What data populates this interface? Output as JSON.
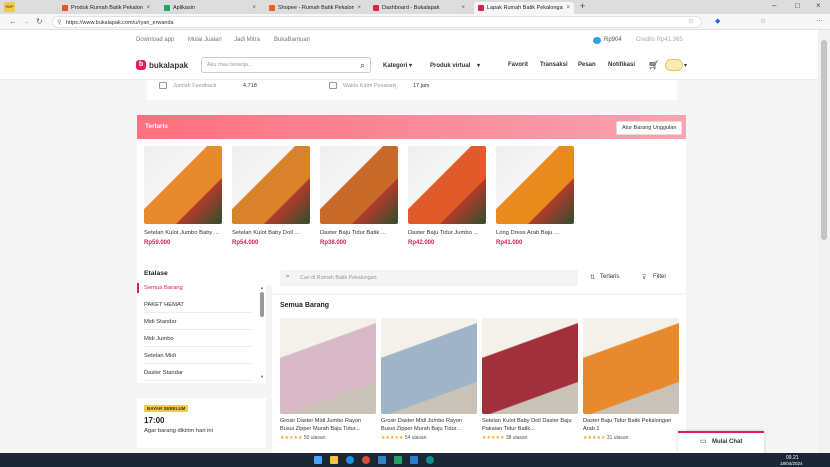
{
  "browser": {
    "tabs": [
      {
        "label": "Produk Rumah Batik Pekalongan",
        "color": "#e8541c"
      },
      {
        "label": "Aplikasin",
        "color": "#1fa463"
      },
      {
        "label": "Shopee - Rumah Batik Pekalongan",
        "color": "#f05d23"
      },
      {
        "label": "Dashboard - Bukalapak",
        "color": "#e31e52"
      },
      {
        "label": "Lapak Rumah Batik Pekalongan",
        "color": "#e31e52"
      }
    ],
    "url": "https://www.bukalapak.com/u/ryan_erwanda"
  },
  "topnav": {
    "download": "Download app",
    "jualan": "Mulai Jualan",
    "mitra": "Jadi Mitra",
    "bantuan": "BukaBantuan",
    "balance": "Rp904",
    "credits": "Credits Rp41.365"
  },
  "header": {
    "logo": "bukalapak",
    "search_placeholder": "Aku mau belanja...",
    "kategori": "Kategori",
    "produk_virtual": "Produk virtual",
    "favorit": "Favorit",
    "transaksi": "Transaksi",
    "pesan": "Pesan",
    "notifikasi": "Notifikasi"
  },
  "stats": {
    "feedback_label": "Jumlah Feedback",
    "feedback_value": "4.718",
    "waktu_label": "Waktu Kirim Pesanan",
    "waktu_value": "17 jam"
  },
  "terlaris": {
    "title": "Terlaris",
    "button": "Atur Barang Unggulan",
    "products": [
      {
        "name": "Setelan Kulot Jumbo Baby ...",
        "price": "Rp59.000",
        "color": "#e8892e"
      },
      {
        "name": "Setelan Kulot Baby Doll ...",
        "price": "Rp54.000",
        "color": "#d8832a"
      },
      {
        "name": "Daster Baju Tidur Batik ...",
        "price": "Rp38.000",
        "color": "#c86b2a"
      },
      {
        "name": "Daster Baju Tidur Jumbo ...",
        "price": "Rp42.000",
        "color": "#e05a2b"
      },
      {
        "name": "Long Dress Arab Baju ...",
        "price": "Rp41.000",
        "color": "#e98a1d"
      }
    ]
  },
  "etalase": {
    "title": "Etalase",
    "items": [
      "Semua Barang",
      "PAKET HEMAT",
      "Midi Standar",
      "Midi Jumbo",
      "Setelan Midi",
      "Daster Standar"
    ]
  },
  "shipping": {
    "badge": "BAYAR SEBELUM",
    "time": "17:00",
    "note": "Agar barang dikirim hari ini"
  },
  "store_search": {
    "placeholder": "Cari di Rumah Batik Pekalongan",
    "sort": "Terlaris",
    "filter": "Filter"
  },
  "semua": {
    "title": "Semua Barang",
    "products": [
      {
        "name": "Grosir Daster Midi Jumbo Rayon Busui Zipper Murah Baju Tidur...",
        "stars": "★★★★★",
        "reviews": "50 ulasan",
        "color": "#d9b9c8"
      },
      {
        "name": "Grosir Daster Midi Jumbo Rayon Busui Zipper Murah Baju Tidur...",
        "stars": "★★★★★",
        "reviews": "54 ulasan",
        "color": "#9fb3c9"
      },
      {
        "name": "Setelan Kulot Baby Doll Daster Baju Pakaian Tidur Batik...",
        "stars": "★★★★★",
        "reviews": "38 ulasan",
        "color": "#a2303a"
      },
      {
        "name": "Daster Baju Tidur Batik Pekalongan Arab 1",
        "stars": "★★★★★",
        "reviews": "31 ulasan",
        "color": "#e8892e"
      }
    ]
  },
  "chat": {
    "label": "Mulai Chat"
  },
  "taskbar": {
    "time": "09.21",
    "date": "18/04/2024"
  }
}
